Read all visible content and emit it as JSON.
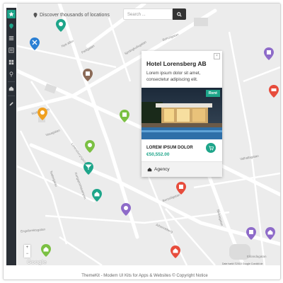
{
  "topbar": {
    "locate_label": "Discover thousands of locations",
    "search_placeholder": "Search ..."
  },
  "sidebar": {
    "items": [
      {
        "icon": "star-icon",
        "active": true
      },
      {
        "icon": "map-marker-icon",
        "active": false
      },
      {
        "icon": "list-icon",
        "active": false
      },
      {
        "icon": "list-detail-icon",
        "active": false
      },
      {
        "icon": "grid-icon",
        "active": false
      },
      {
        "icon": "pin-icon",
        "active": false
      },
      {
        "icon": "home-icon",
        "active": false
      },
      {
        "icon": "edit-icon",
        "active": false
      }
    ]
  },
  "map": {
    "streets": [
      "Nya allén",
      "Parkgatan",
      "Sprängkullsgatan",
      "Bohusgatan",
      "Södra Vägen",
      "Vasagatan",
      "Teatergatan",
      "Kungsportsavenyen",
      "Lorensbergsgatan",
      "Engelbrektsgatan",
      "Berzeliigatan",
      "Johanneberg",
      "Skånegatan",
      "Valhallagatan",
      "Eklandagatan"
    ],
    "attribution": "Date hartă ©2015 Google   Condiții de",
    "google_logo": "Google",
    "zoom_in": "+",
    "zoom_out": "−",
    "pin_colors": {
      "teal": "#1ea58a",
      "blue": "#2a7fd4",
      "brown": "#8b6a57",
      "orange": "#f0a020",
      "green": "#7bc043",
      "red": "#e74c3c",
      "purple": "#8e6bc9"
    }
  },
  "card": {
    "title": "Hotel Lorensberg AB",
    "description": "Lorem ipsum dolor sit amet, consectetur adipiscing elit.",
    "badge": "Rent",
    "property_label": "LOREM IPSUM DOLOR",
    "price": "€50,552.00",
    "category": "Agency",
    "close": "×"
  },
  "footer": {
    "text": "ThemeKit - Modern UI Kits for Apps & Websites © Copyright Notice"
  }
}
